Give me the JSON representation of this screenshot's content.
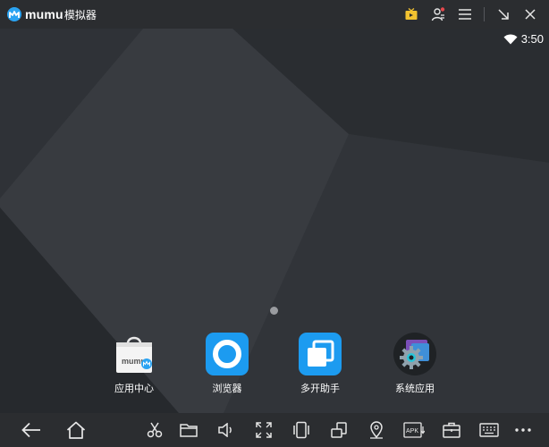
{
  "titlebar": {
    "brand": "mumu",
    "brand_sub": "模拟器",
    "icons": [
      "tv-icon",
      "account-icon",
      "menu-icon",
      "minimize-icon",
      "close-icon"
    ]
  },
  "statusbar": {
    "time": "3:50",
    "icons": [
      "wifi-icon"
    ]
  },
  "apps": [
    {
      "label": "应用中心",
      "icon": "app-center-icon"
    },
    {
      "label": "浏览器",
      "icon": "browser-icon"
    },
    {
      "label": "多开助手",
      "icon": "multi-instance-icon"
    },
    {
      "label": "系统应用",
      "icon": "system-apps-icon"
    }
  ],
  "navbar": {
    "left": [
      "back-icon",
      "home-icon"
    ],
    "right": [
      "scissors-icon",
      "folder-icon",
      "volume-icon",
      "fullscreen-icon",
      "shake-icon",
      "rotate-icon",
      "location-icon",
      "apk-install-icon",
      "toolbox-icon",
      "keyboard-icon",
      "more-icon"
    ],
    "apk_label": "APK"
  },
  "colors": {
    "titlebar": "#2b2d30",
    "screen": "#33363b",
    "accent": "#2aa3f2"
  }
}
